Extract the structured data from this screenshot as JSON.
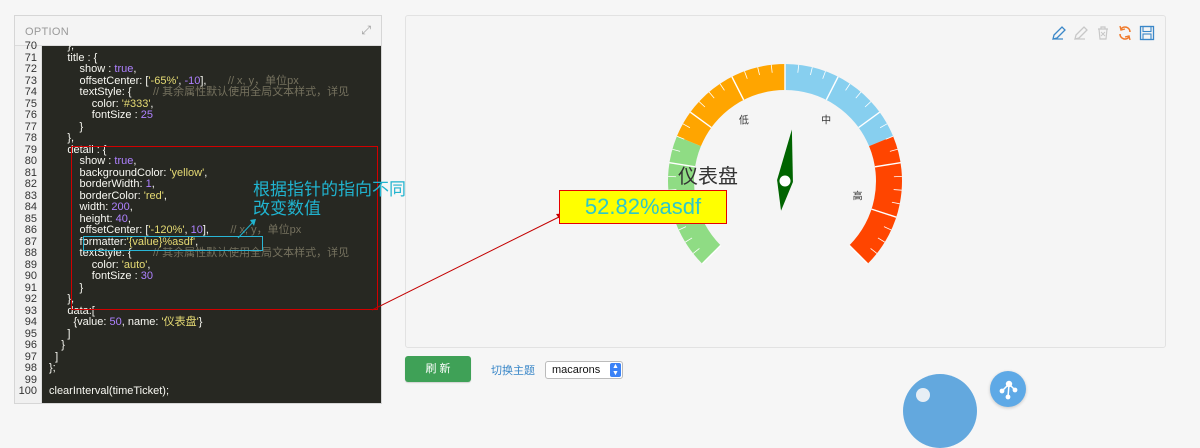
{
  "option_panel": {
    "title": "OPTION",
    "lines": [
      {
        "num": "70",
        "text": "      },"
      },
      {
        "num": "71",
        "text": "      title : {"
      },
      {
        "num": "72",
        "text": "          show : true,"
      },
      {
        "num": "73",
        "text": "          offsetCenter: ['-65%', -10],       // x, y，单位px"
      },
      {
        "num": "74",
        "text": "          textStyle: {       // 其余属性默认使用全局文本样式，详见"
      },
      {
        "num": "75",
        "text": "              color: '#333',"
      },
      {
        "num": "76",
        "text": "              fontSize : 25"
      },
      {
        "num": "77",
        "text": "          }"
      },
      {
        "num": "78",
        "text": "      },"
      },
      {
        "num": "79",
        "text": "      detail : {"
      },
      {
        "num": "80",
        "text": "          show : true,"
      },
      {
        "num": "81",
        "text": "          backgroundColor: 'yellow',"
      },
      {
        "num": "82",
        "text": "          borderWidth: 1,"
      },
      {
        "num": "83",
        "text": "          borderColor: 'red',"
      },
      {
        "num": "84",
        "text": "          width: 200,"
      },
      {
        "num": "85",
        "text": "          height: 40,"
      },
      {
        "num": "86",
        "text": "          offsetCenter: ['-120%', 10],       // x, y，单位px"
      },
      {
        "num": "87",
        "text": "          formatter:'{value}%asdf',"
      },
      {
        "num": "88",
        "text": "          textStyle: {       // 其余属性默认使用全局文本样式，详见"
      },
      {
        "num": "89",
        "text": "              color: 'auto',"
      },
      {
        "num": "90",
        "text": "              fontSize : 30"
      },
      {
        "num": "91",
        "text": "          }"
      },
      {
        "num": "92",
        "text": "      },"
      },
      {
        "num": "93",
        "text": "      data:["
      },
      {
        "num": "94",
        "text": "        {value: 50, name: '仪表盘'}"
      },
      {
        "num": "95",
        "text": "      ]"
      },
      {
        "num": "96",
        "text": "    }"
      },
      {
        "num": "97",
        "text": "  ]"
      },
      {
        "num": "98",
        "text": "};"
      },
      {
        "num": "99",
        "text": ""
      },
      {
        "num": "100",
        "text": "clearInterval(timeTicket);"
      }
    ]
  },
  "annotation": {
    "line1": "根据指针的指向不同，",
    "line2": "改变数值",
    "box_color": "#d20000",
    "text_color": "#20b3cf"
  },
  "toolbar": {
    "icons": [
      "pencil-icon",
      "eraser-icon",
      "trash-icon",
      "refresh-icon",
      "save-icon"
    ]
  },
  "gauge": {
    "title": "仪表盘",
    "detail_text": "52.82%asdf",
    "value": 52.82,
    "range": [
      0,
      100
    ],
    "segments": [
      {
        "label": "弱",
        "color": "#8fdc84"
      },
      {
        "label": "低",
        "color": "#ffa500"
      },
      {
        "label": "中",
        "color": "#87cfef"
      },
      {
        "label": "高",
        "color": "#ff4500"
      }
    ],
    "pointer_color": "#006400",
    "detail_bg": "yellow",
    "detail_border": "#e60000",
    "detail_text_color": "#2ec7c9"
  },
  "controls": {
    "refresh_label": "刷 新",
    "theme_label": "切换主题",
    "theme_value": "macarons"
  }
}
